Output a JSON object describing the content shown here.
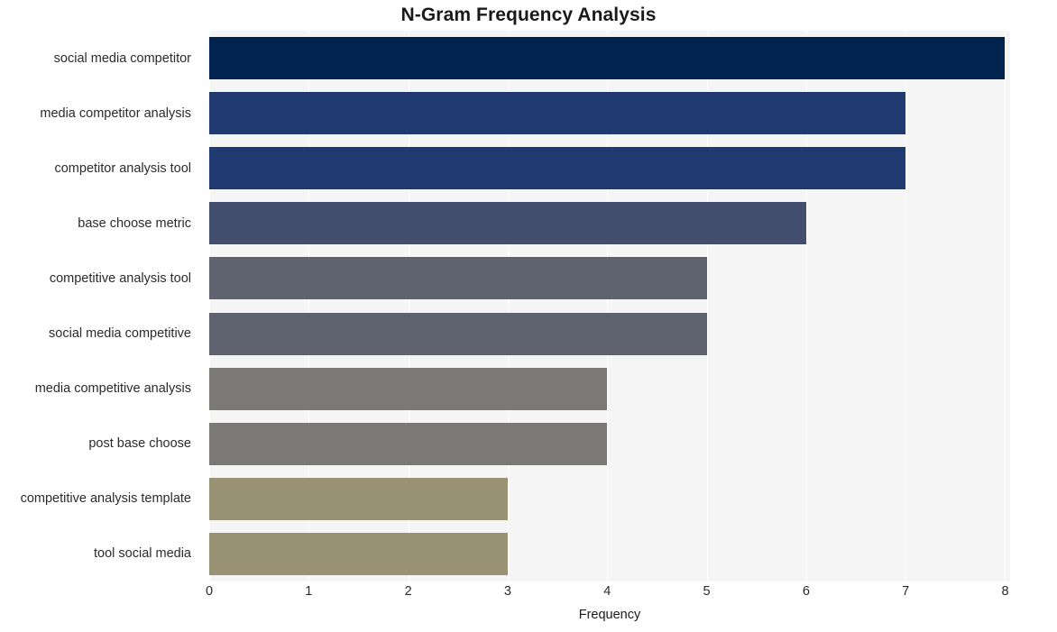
{
  "chart_data": {
    "type": "bar",
    "orientation": "horizontal",
    "title": "N-Gram Frequency Analysis",
    "xlabel": "Frequency",
    "ylabel": "",
    "categories": [
      "social media competitor",
      "media competitor analysis",
      "competitor analysis tool",
      "base choose metric",
      "competitive analysis tool",
      "social media competitive",
      "media competitive analysis",
      "post base choose",
      "competitive analysis template",
      "tool social media"
    ],
    "values": [
      8,
      7,
      7,
      6,
      5,
      5,
      4,
      4,
      3,
      3
    ],
    "bar_colors": [
      "#00234f",
      "#1e3a70",
      "#1e3a70",
      "#434d6e",
      "#5f6370",
      "#5f6370",
      "#7a7975",
      "#7a7975",
      "#9a9274",
      "#9a9274"
    ],
    "xlim": [
      0,
      8.05
    ],
    "xticks": [
      0,
      1,
      2,
      3,
      4,
      5,
      6,
      7,
      8
    ],
    "xtick_labels": [
      "0",
      "1",
      "2",
      "3",
      "4",
      "5",
      "6",
      "7",
      "8"
    ],
    "grid": true,
    "grid_axis": "x",
    "grid_color": "#ffffff",
    "plot_background": "#f5f5f6",
    "figure_background": "#ffffff",
    "legend": null
  }
}
